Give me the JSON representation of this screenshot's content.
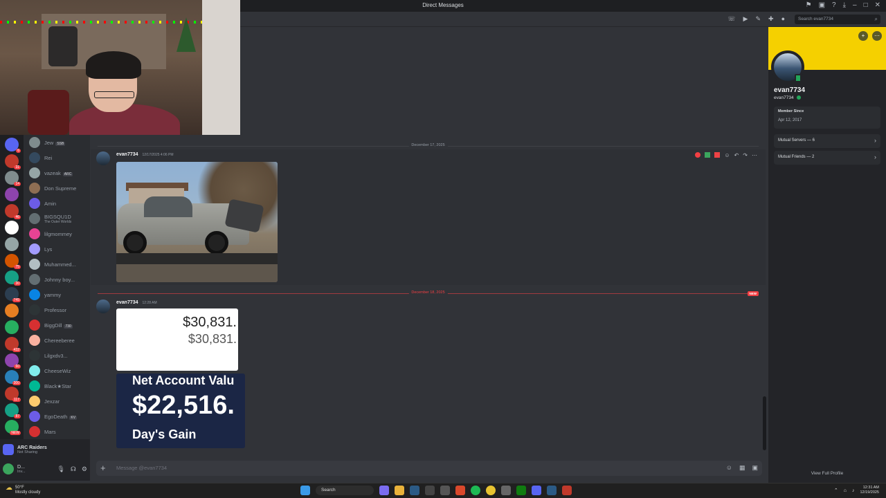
{
  "window": {
    "title": "Direct Messages"
  },
  "servers": [
    {
      "color": "#5865f2",
      "badge": "6"
    },
    {
      "color": "#c0392b",
      "badge": "31"
    },
    {
      "color": "#7f8c8d",
      "badge": "14"
    },
    {
      "color": "#8e44ad",
      "badge": ""
    },
    {
      "color": "#c0392b",
      "badge": "46"
    },
    {
      "color": "#ffffff",
      "badge": ""
    },
    {
      "color": "#95a5a6",
      "badge": ""
    },
    {
      "color": "#d35400",
      "badge": "75"
    },
    {
      "color": "#16a085",
      "badge": "30"
    },
    {
      "color": "#2c3e50",
      "badge": "745"
    },
    {
      "color": "#e67e22",
      "badge": ""
    },
    {
      "color": "#27ae60",
      "badge": ""
    },
    {
      "color": "#c0392b",
      "badge": "432"
    },
    {
      "color": "#8e44ad",
      "badge": "60"
    },
    {
      "color": "#2980b9",
      "badge": "300"
    },
    {
      "color": "#c0392b",
      "badge": "117"
    },
    {
      "color": "#16a085",
      "badge": "87"
    },
    {
      "color": "#27ae60",
      "badge": "NEW"
    }
  ],
  "dms": [
    {
      "name": "Jew",
      "tag": "SSB",
      "sub": "",
      "color": "#7f8c8d"
    },
    {
      "name": "Rei",
      "tag": "",
      "sub": "",
      "color": "#34495e"
    },
    {
      "name": "vazeak",
      "tag": "ARC",
      "sub": "",
      "color": "#95a5a6"
    },
    {
      "name": "Don Supreme",
      "tag": "",
      "sub": "",
      "color": "#8e6e53"
    },
    {
      "name": "Amin",
      "tag": "",
      "sub": "",
      "color": "#6c5ce7"
    },
    {
      "name": "BIGSQU1D",
      "tag": "",
      "sub": "The Outer Worlds",
      "color": "#636e72"
    },
    {
      "name": "lilgmommey",
      "tag": "",
      "sub": "",
      "color": "#e84393"
    },
    {
      "name": "Lys",
      "tag": "",
      "sub": "",
      "color": "#a29bfe"
    },
    {
      "name": "Muhammed...",
      "tag": "",
      "sub": "",
      "color": "#b2bec3"
    },
    {
      "name": "Johnny boy...",
      "tag": "",
      "sub": "",
      "color": "#636e72"
    },
    {
      "name": "yammy",
      "tag": "",
      "sub": "",
      "color": "#0984e3"
    },
    {
      "name": "Professor",
      "tag": "",
      "sub": "",
      "color": "#2d3436"
    },
    {
      "name": "BiggDill",
      "tag": "730",
      "sub": "",
      "color": "#d63031"
    },
    {
      "name": "Chereeberee",
      "tag": "",
      "sub": "",
      "color": "#fab1a0"
    },
    {
      "name": "Lilgxdv3...",
      "tag": "",
      "sub": "",
      "color": "#2d3436"
    },
    {
      "name": "CheeseWiz",
      "tag": "",
      "sub": "",
      "color": "#81ecec"
    },
    {
      "name": "Black★Star",
      "tag": "",
      "sub": "",
      "color": "#00b894"
    },
    {
      "name": "Jexzar",
      "tag": "",
      "sub": "",
      "color": "#fdcb6e"
    },
    {
      "name": "EgoDeath",
      "tag": "KV",
      "sub": "",
      "color": "#6c5ce7"
    },
    {
      "name": "Mars",
      "tag": "",
      "sub": "",
      "color": "#d63031"
    }
  ],
  "activity": {
    "title": "ARC Raiders",
    "status": "Not Sharing"
  },
  "me": {
    "name": "D...",
    "status": "Inv..."
  },
  "search": {
    "placeholder": "Search evan7734"
  },
  "chat": {
    "divider1": "December 17, 2025",
    "msg1": {
      "author": "evan7734",
      "time": "12/17/2025 4:06 PM"
    },
    "divider2": "December 18, 2025",
    "new_label": "NEW",
    "msg2": {
      "author": "evan7734",
      "time": "12:28 AM"
    },
    "stock1": {
      "line1": "$30,831.",
      "line2": "$30,831."
    },
    "stock2": {
      "line1": "Net Account Valu",
      "line2": "$22,516.",
      "line3": "Day's Gain"
    }
  },
  "composer": {
    "placeholder": "Message @evan7734"
  },
  "profile": {
    "display_name": "evan7734",
    "username": "evan7734",
    "member_since_label": "Member Since",
    "member_since": "Apr 12, 2017",
    "mutual_servers": "Mutual Servers — 6",
    "mutual_friends": "Mutual Friends — 2",
    "view_full": "View Full Profile",
    "banner_color": "#f5d000"
  },
  "taskbar": {
    "temp": "50°F",
    "weather": "Mostly cloudy",
    "search": "Search",
    "time": "12:31 AM",
    "date": "12/19/2025"
  }
}
